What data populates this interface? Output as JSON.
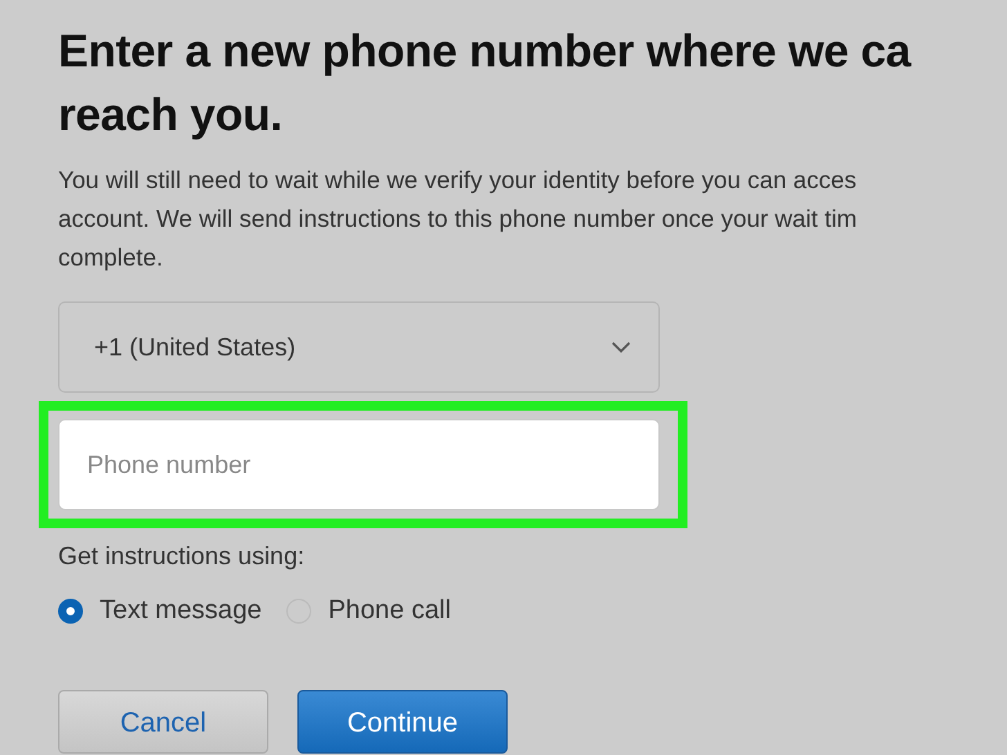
{
  "heading": "Enter a new phone number where we ca\nreach you.",
  "description": "You will still need to wait while we verify your identity before you can acces\naccount. We will send instructions to this phone number once your wait tim\ncomplete.",
  "country_select": {
    "value": "+1 (United States)"
  },
  "phone_field": {
    "placeholder": "Phone number",
    "highlighted": true
  },
  "method_label": "Get instructions using:",
  "methods": [
    {
      "label": "Text message",
      "selected": true
    },
    {
      "label": "Phone call",
      "selected": false
    }
  ],
  "buttons": [
    {
      "label": "Cancel",
      "kind": "secondary"
    },
    {
      "label": "Continue",
      "kind": "primary"
    }
  ]
}
